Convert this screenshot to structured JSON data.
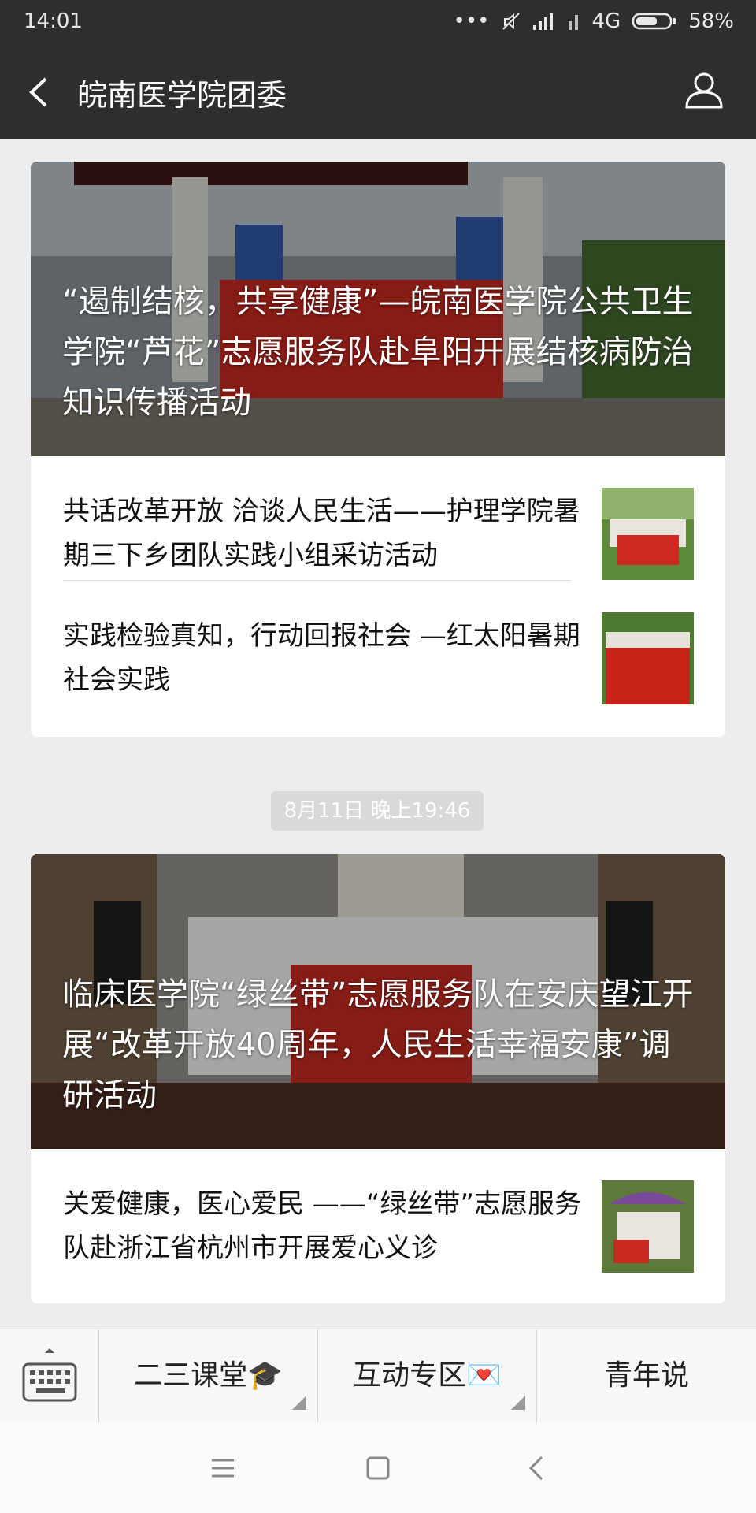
{
  "status": {
    "time": "14:01",
    "network": "4G",
    "battery": "58%"
  },
  "nav": {
    "title": "皖南医学院团委"
  },
  "group1": {
    "hero_title": "“遏制结核，共享健康”—皖南医学院公共卫生学院“芦花”志愿服务队赴阜阳开展结核病防治知识传播活动",
    "items": [
      {
        "text": "共话改革开放 洽谈人民生活——护理学院暑期三下乡团队实践小组采访活动"
      },
      {
        "text": "实践检验真知，行动回报社会 —红太阳暑期社会实践"
      }
    ]
  },
  "date_badge": "8月11日 晚上19:46",
  "group2": {
    "hero_title": "临床医学院“绿丝带”志愿服务队在安庆望江开展“改革开放40周年，人民生活幸福安康”调研活动",
    "items": [
      {
        "text": "关爱健康，医心爱民 ——“绿丝带”志愿服务队赴浙江省杭州市开展爱心义诊"
      }
    ]
  },
  "menu": {
    "items": [
      {
        "label": "二三课堂🎓"
      },
      {
        "label": "互动专区💌"
      },
      {
        "label": "青年说"
      }
    ]
  },
  "colors": {
    "header": "#2e2e2e",
    "background": "#ededed",
    "banner_red": "#c8281e"
  }
}
